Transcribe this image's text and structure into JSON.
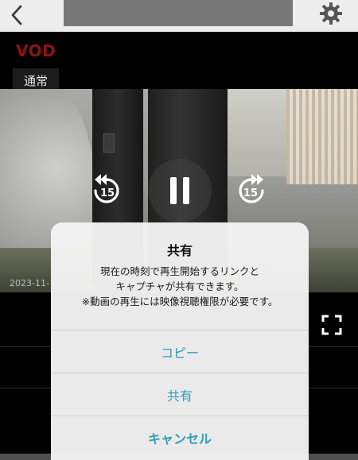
{
  "header": {
    "back_icon": "chevron-left-icon",
    "settings_icon": "gear-icon"
  },
  "player": {
    "mode_label": "VOD",
    "quality_label": "通常",
    "timestamp": "2023-11-",
    "rewind_seconds": "15",
    "forward_seconds": "15",
    "pause_icon": "pause-icon",
    "fullscreen_icon": "fullscreen-icon"
  },
  "dialog": {
    "title": "共有",
    "message_line1": "現在の時刻で再生開始するリンクと",
    "message_line2": "キャプチャが共有できます。",
    "message_line3": "※動画の再生には映像視聴権限が必要です。",
    "buttons": {
      "copy": "コピー",
      "share": "共有",
      "cancel": "キャンセル"
    }
  },
  "colors": {
    "accent": "#2f9db3",
    "vod_red": "#8e1414"
  }
}
